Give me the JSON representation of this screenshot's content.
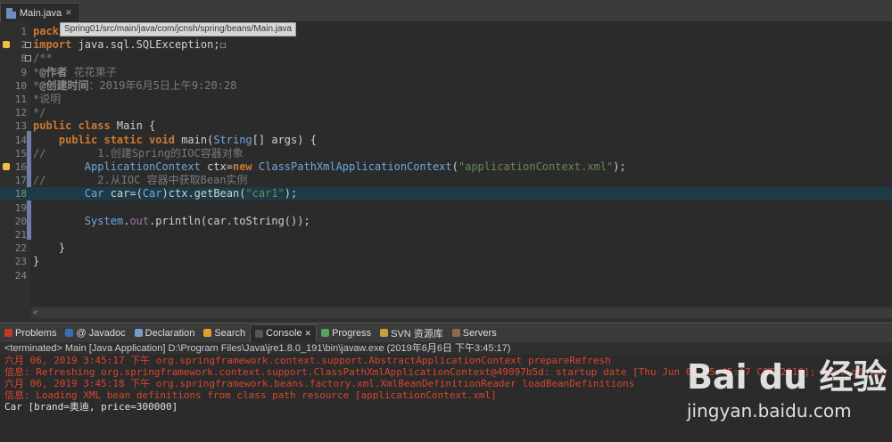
{
  "tab": {
    "label": "Main.java",
    "close": "✕"
  },
  "tooltip": "Spring01/src/main/java/com/jcnsh/spring/beans/Main.java",
  "editor": {
    "lines": [
      {
        "n": "1",
        "parts": [
          {
            "c": "kw",
            "t": "pack"
          }
        ]
      },
      {
        "n": "2",
        "parts": [
          {
            "c": "kw",
            "t": "import"
          },
          {
            "c": "pl",
            "t": " java.sql.SQLException;"
          },
          {
            "c": "pl",
            "t": "☐"
          }
        ]
      },
      {
        "n": "8",
        "parts": [
          {
            "c": "cm",
            "t": "/**"
          }
        ]
      },
      {
        "n": "9",
        "parts": [
          {
            "c": "cm",
            "t": "*"
          },
          {
            "c": "cmb",
            "t": "@作者"
          },
          {
            "c": "cm",
            "t": " 花花果子"
          }
        ]
      },
      {
        "n": "10",
        "parts": [
          {
            "c": "cm",
            "t": "*"
          },
          {
            "c": "cmb",
            "t": "@创建时间"
          },
          {
            "c": "cm",
            "t": "：2019年6月5日上午9:20:28"
          }
        ]
      },
      {
        "n": "11",
        "parts": [
          {
            "c": "cm",
            "t": "*说明"
          }
        ]
      },
      {
        "n": "12",
        "parts": [
          {
            "c": "cm",
            "t": "*/"
          }
        ]
      },
      {
        "n": "13",
        "parts": [
          {
            "c": "kw",
            "t": "public class "
          },
          {
            "c": "pl",
            "t": "Main {"
          }
        ]
      },
      {
        "n": "14",
        "parts": [
          {
            "c": "pl",
            "t": "    "
          },
          {
            "c": "kw",
            "t": "public static void "
          },
          {
            "c": "pl",
            "t": "main("
          },
          {
            "c": "ty",
            "t": "String"
          },
          {
            "c": "pl",
            "t": "[] args) {"
          }
        ]
      },
      {
        "n": "15",
        "parts": [
          {
            "c": "cm",
            "t": "//        1.创建Spring的IOC容器对象"
          }
        ]
      },
      {
        "n": "16",
        "parts": [
          {
            "c": "pl",
            "t": "        "
          },
          {
            "c": "ty",
            "t": "ApplicationContext "
          },
          {
            "c": "pl",
            "t": "ctx="
          },
          {
            "c": "kw",
            "t": "new "
          },
          {
            "c": "ty",
            "t": "ClassPathXmlApplicationContext"
          },
          {
            "c": "pl",
            "t": "("
          },
          {
            "c": "st",
            "t": "\"applicationContext.xml\""
          },
          {
            "c": "pl",
            "t": ");"
          }
        ]
      },
      {
        "n": "17",
        "parts": [
          {
            "c": "cm",
            "t": "//        2.从IOC 容器中获取Bean实例"
          }
        ]
      },
      {
        "n": "18",
        "parts": [
          {
            "c": "pl",
            "t": "        "
          },
          {
            "c": "ty",
            "t": "Car "
          },
          {
            "c": "pl",
            "t": "car=("
          },
          {
            "c": "ty",
            "t": "Car"
          },
          {
            "c": "pl",
            "t": ")ctx.getBean("
          },
          {
            "c": "st",
            "t": "\"car1\""
          },
          {
            "c": "pl",
            "t": ");"
          }
        ]
      },
      {
        "n": "19",
        "parts": []
      },
      {
        "n": "20",
        "parts": [
          {
            "c": "pl",
            "t": "        "
          },
          {
            "c": "ty",
            "t": "System"
          },
          {
            "c": "pl",
            "t": "."
          },
          {
            "c": "fi",
            "t": "out"
          },
          {
            "c": "pl",
            "t": ".println(car.toString());"
          }
        ]
      },
      {
        "n": "21",
        "parts": []
      },
      {
        "n": "22",
        "parts": [
          {
            "c": "pl",
            "t": "    }"
          }
        ]
      },
      {
        "n": "23",
        "parts": [
          {
            "c": "pl",
            "t": "}"
          }
        ]
      },
      {
        "n": "24",
        "parts": []
      }
    ]
  },
  "views": [
    {
      "label": "Problems",
      "color": "#c0392b"
    },
    {
      "label": "@ Javadoc",
      "color": "#3b6db5"
    },
    {
      "label": "Declaration",
      "color": "#7a9cc9"
    },
    {
      "label": "Search",
      "color": "#e0a030"
    },
    {
      "label": "Console",
      "color": "#555",
      "active": true,
      "close": "✕"
    },
    {
      "label": "Progress",
      "color": "#5aa05a"
    },
    {
      "label": "SVN 资源库",
      "color": "#c8a040"
    },
    {
      "label": "Servers",
      "color": "#8a6a4a"
    }
  ],
  "console": {
    "terminated": "<terminated> Main [Java Application] D:\\Program Files\\Java\\jre1.8.0_191\\bin\\javaw.exe (2019年6月6日 下午3:45:17)",
    "lines": [
      {
        "c": "red",
        "t": "六月 06, 2019 3:45:17 下午 org.springframework.context.support.AbstractApplicationContext prepareRefresh"
      },
      {
        "c": "red",
        "t": "信息: Refreshing org.springframework.context.support.ClassPathXmlApplicationContext@49097b5d: startup date [Thu Jun 06 15:45:17 CST 2019]; root of con"
      },
      {
        "c": "red",
        "t": "六月 06, 2019 3:45:18 下午 org.springframework.beans.factory.xml.XmlBeanDefinitionReader loadBeanDefinitions"
      },
      {
        "c": "red",
        "t": "信息: Loading XML bean definitions from class path resource [applicationContext.xml]"
      },
      {
        "c": "wht",
        "t": "Car [brand=奥迪, price=300000]"
      }
    ]
  },
  "watermark": {
    "logo": "Bai du 经验",
    "sub": "jingyan.baidu.com"
  }
}
